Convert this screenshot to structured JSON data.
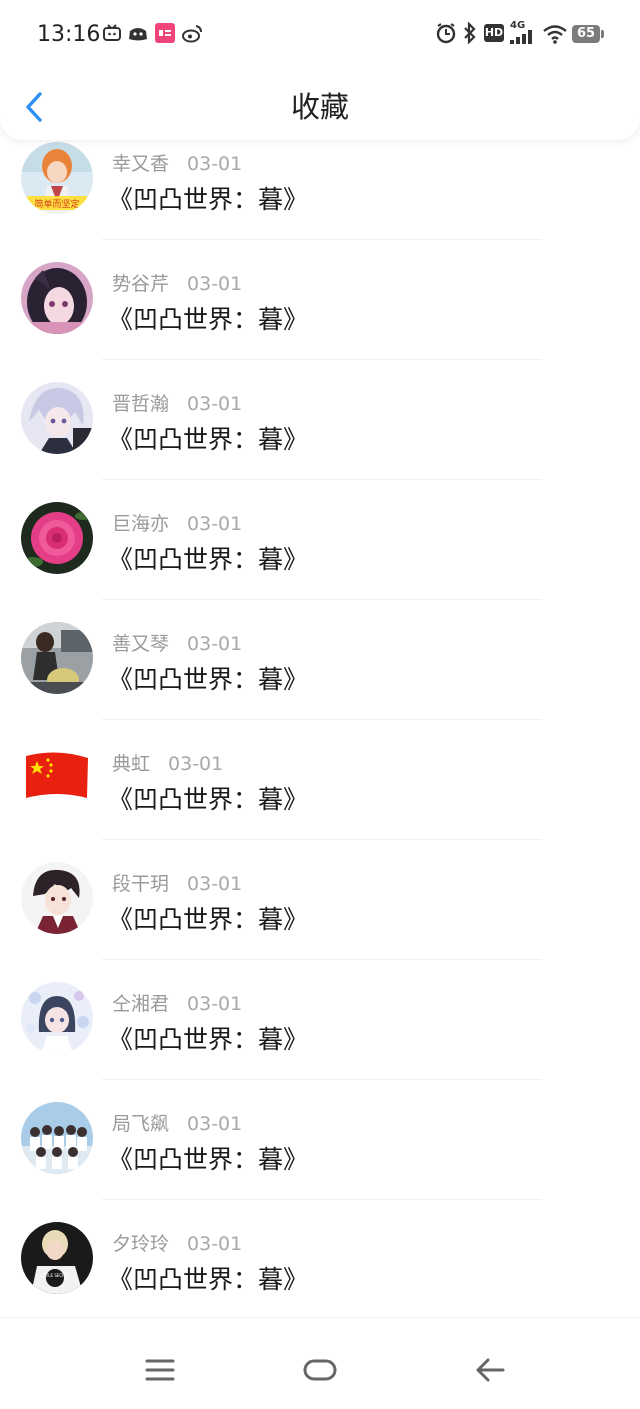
{
  "status_bar": {
    "time": "13:16",
    "battery": "65",
    "network": "4G",
    "hd": "HD"
  },
  "header": {
    "title": "收藏"
  },
  "favorites": [
    {
      "user": "幸又香",
      "date": "03-01",
      "book": "《凹凸世界：暮》",
      "avatar": "anime-girl-orange-hair"
    },
    {
      "user": "势谷芹",
      "date": "03-01",
      "book": "《凹凸世界：暮》",
      "avatar": "anime-girl-purple"
    },
    {
      "user": "晋哲瀚",
      "date": "03-01",
      "book": "《凹凸世界：暮》",
      "avatar": "anime-boy-white-hair"
    },
    {
      "user": "巨海亦",
      "date": "03-01",
      "book": "《凹凸世界：暮》",
      "avatar": "pink-rose"
    },
    {
      "user": "善又琴",
      "date": "03-01",
      "book": "《凹凸世界：暮》",
      "avatar": "person-on-scooter"
    },
    {
      "user": "典虹",
      "date": "03-01",
      "book": "《凹凸世界：暮》",
      "avatar": "china-flag"
    },
    {
      "user": "段干玥",
      "date": "03-01",
      "book": "《凹凸世界：暮》",
      "avatar": "anime-boy-dark-hair"
    },
    {
      "user": "仝湘君",
      "date": "03-01",
      "book": "《凹凸世界：暮》",
      "avatar": "anime-girl-flowers"
    },
    {
      "user": "局飞飙",
      "date": "03-01",
      "book": "《凹凸世界：暮》",
      "avatar": "group-photo"
    },
    {
      "user": "夕玲玲",
      "date": "03-01",
      "book": "《凹凸世界：暮》",
      "avatar": "person-white-tshirt"
    }
  ],
  "avatar_text": {
    "sticker_caption": "简单而坚定",
    "shirt_text": "LITTLE SECRET"
  },
  "colors": {
    "accent": "#2b8ff5",
    "meta_text": "#9a9a9a",
    "title_text": "#222222"
  }
}
